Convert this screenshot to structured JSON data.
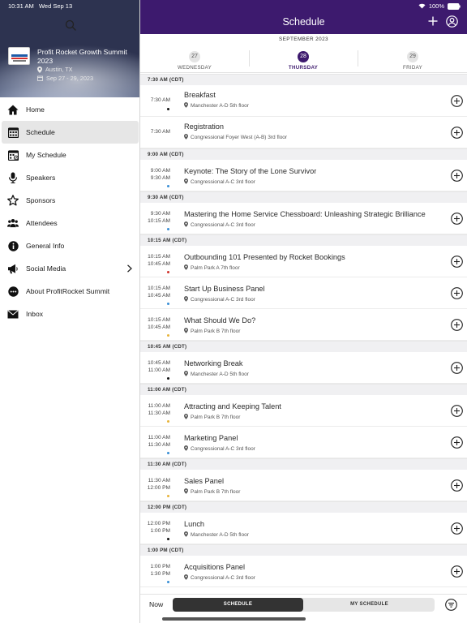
{
  "status": {
    "time": "10:31 AM",
    "date": "Wed Sep 13",
    "battery": "100%"
  },
  "event": {
    "name": "Profit Rocket Growth Summit 2023",
    "location": "Austin, TX",
    "dates": "Sep 27 - 29, 2023"
  },
  "nav": [
    {
      "label": "Home",
      "icon": "home-icon"
    },
    {
      "label": "Schedule",
      "icon": "calendar-grid-icon",
      "active": true
    },
    {
      "label": "My Schedule",
      "icon": "my-schedule-icon"
    },
    {
      "label": "Speakers",
      "icon": "microphone-icon"
    },
    {
      "label": "Sponsors",
      "icon": "star-icon"
    },
    {
      "label": "Attendees",
      "icon": "people-icon"
    },
    {
      "label": "General Info",
      "icon": "info-icon"
    },
    {
      "label": "Social Media",
      "icon": "megaphone-icon",
      "has_chevron": true
    },
    {
      "label": "About ProfitRocket Summit",
      "icon": "ellipsis-circle-icon"
    },
    {
      "label": "Inbox",
      "icon": "envelope-icon"
    }
  ],
  "header": {
    "title": "Schedule"
  },
  "date_strip": {
    "month": "SEPTEMBER 2023",
    "days": [
      {
        "num": "27",
        "name": "WEDNESDAY",
        "selected": false
      },
      {
        "num": "28",
        "name": "THURSDAY",
        "selected": true
      },
      {
        "num": "29",
        "name": "FRIDAY",
        "selected": false
      }
    ]
  },
  "colors": {
    "header": "#3d1a6e",
    "dot_black": "#111111",
    "dot_blue": "#3a8fd6",
    "dot_red": "#d0342c",
    "dot_yellow": "#e8b43a"
  },
  "schedule": [
    {
      "header": "7:30 AM (CDT)",
      "sessions": [
        {
          "start": "7:30 AM",
          "end": "",
          "title": "Breakfast",
          "room": "Manchester A-D  5th floor",
          "dot": "#111111"
        },
        {
          "start": "7:30 AM",
          "end": "",
          "title": "Registration",
          "room": "Congressional Foyer West (A-B) 3rd floor",
          "dot": ""
        }
      ]
    },
    {
      "header": "9:00 AM (CDT)",
      "sessions": [
        {
          "start": "9:00 AM",
          "end": "9:30 AM",
          "title": "Keynote: The Story of the Lone Survivor",
          "room": "Congressional A-C 3rd floor",
          "dot": "#3a8fd6"
        }
      ]
    },
    {
      "header": "9:30 AM (CDT)",
      "sessions": [
        {
          "start": "9:30 AM",
          "end": "10:15 AM",
          "title": "Mastering the Home Service Chessboard: Unleashing Strategic Brilliance",
          "room": "Congressional A-C 3rd floor",
          "dot": "#3a8fd6"
        }
      ]
    },
    {
      "header": "10:15 AM (CDT)",
      "sessions": [
        {
          "start": "10:15 AM",
          "end": "10:45 AM",
          "title": "Outbounding 101 Presented by Rocket Bookings",
          "room": "Palm Park A 7th floor",
          "dot": "#d0342c"
        },
        {
          "start": "10:15 AM",
          "end": "10:45 AM",
          "title": "Start Up Business Panel",
          "room": "Congressional A-C 3rd floor",
          "dot": "#3a8fd6"
        },
        {
          "start": "10:15 AM",
          "end": "10:45 AM",
          "title": "What Should We Do?",
          "room": "Palm Park B 7th floor",
          "dot": "#e8b43a"
        }
      ]
    },
    {
      "header": "10:45 AM (CDT)",
      "sessions": [
        {
          "start": "10:45 AM",
          "end": "11:00 AM",
          "title": "Networking Break",
          "room": "Manchester A-D  5th floor",
          "dot": "#111111"
        }
      ]
    },
    {
      "header": "11:00 AM (CDT)",
      "sessions": [
        {
          "start": "11:00 AM",
          "end": "11:30 AM",
          "title": "Attracting and Keeping Talent",
          "room": "Palm Park B 7th floor",
          "dot": "#e8b43a"
        },
        {
          "start": "11:00 AM",
          "end": "11:30 AM",
          "title": "Marketing Panel",
          "room": "Congressional A-C 3rd floor",
          "dot": "#3a8fd6"
        }
      ]
    },
    {
      "header": "11:30 AM (CDT)",
      "sessions": [
        {
          "start": "11:30 AM",
          "end": "12:00 PM",
          "title": "Sales Panel",
          "room": "Palm Park B 7th floor",
          "dot": "#e8b43a"
        }
      ]
    },
    {
      "header": "12:00 PM (CDT)",
      "sessions": [
        {
          "start": "12:00 PM",
          "end": "1:00 PM",
          "title": "Lunch",
          "room": "Manchester A-D  5th floor",
          "dot": "#111111"
        }
      ]
    },
    {
      "header": "1:00 PM (CDT)",
      "sessions": [
        {
          "start": "1:00 PM",
          "end": "1:30 PM",
          "title": "Acquisitions Panel",
          "room": "Congressional A-C 3rd floor",
          "dot": "#3a8fd6"
        }
      ]
    }
  ],
  "bottom": {
    "now": "Now",
    "tab_schedule": "SCHEDULE",
    "tab_my_schedule": "MY SCHEDULE"
  }
}
